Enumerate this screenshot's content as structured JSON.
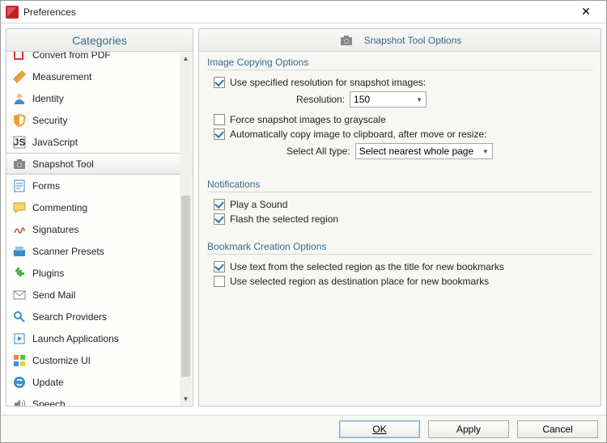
{
  "window": {
    "title": "Preferences"
  },
  "categories": {
    "header": "Categories",
    "items": [
      {
        "label": "Convert from PDF",
        "icon": "convert"
      },
      {
        "label": "Measurement",
        "icon": "ruler"
      },
      {
        "label": "Identity",
        "icon": "identity"
      },
      {
        "label": "Security",
        "icon": "shield"
      },
      {
        "label": "JavaScript",
        "icon": "js"
      },
      {
        "label": "Snapshot Tool",
        "icon": "camera",
        "selected": true
      },
      {
        "label": "Forms",
        "icon": "forms"
      },
      {
        "label": "Commenting",
        "icon": "comment"
      },
      {
        "label": "Signatures",
        "icon": "signature"
      },
      {
        "label": "Scanner Presets",
        "icon": "scanner"
      },
      {
        "label": "Plugins",
        "icon": "plugin"
      },
      {
        "label": "Send Mail",
        "icon": "mail"
      },
      {
        "label": "Search Providers",
        "icon": "search"
      },
      {
        "label": "Launch Applications",
        "icon": "launch"
      },
      {
        "label": "Customize UI",
        "icon": "customize"
      },
      {
        "label": "Update",
        "icon": "update"
      },
      {
        "label": "Speech",
        "icon": "speech"
      }
    ]
  },
  "panel": {
    "title": "Snapshot Tool Options",
    "groups": {
      "copying": {
        "title": "Image Copying Options",
        "use_res": {
          "checked": true,
          "label": "Use specified resolution for snapshot images:"
        },
        "res_label": "Resolution:",
        "res_value": "150",
        "grayscale": {
          "checked": false,
          "label": "Force snapshot images to grayscale"
        },
        "autocopy": {
          "checked": true,
          "label": "Automatically copy image to clipboard, after move or resize:"
        },
        "selectall_label": "Select All type:",
        "selectall_value": "Select nearest whole page"
      },
      "notifications": {
        "title": "Notifications",
        "sound": {
          "checked": true,
          "label": "Play a Sound"
        },
        "flash": {
          "checked": true,
          "label": "Flash the selected region"
        }
      },
      "bookmarks": {
        "title": "Bookmark Creation Options",
        "use_text": {
          "checked": true,
          "label": "Use text from the selected region as the title for new bookmarks"
        },
        "use_region": {
          "checked": false,
          "label": "Use selected region as destination place for new bookmarks"
        }
      }
    }
  },
  "buttons": {
    "ok": "OK",
    "apply": "Apply",
    "cancel": "Cancel"
  }
}
